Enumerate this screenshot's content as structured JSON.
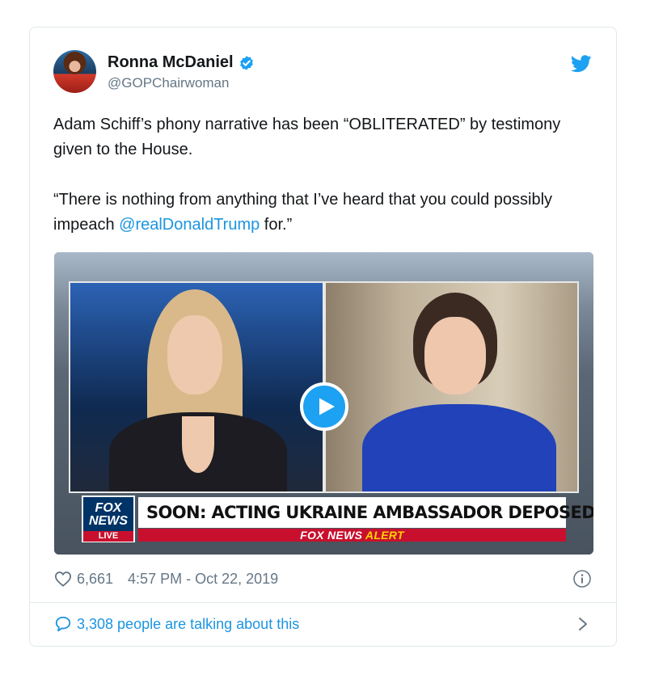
{
  "tweet": {
    "author_name": "Ronna McDaniel",
    "handle": "@GOPChairwoman",
    "verified": true,
    "text_para1": "Adam Schiff’s phony narrative has been “OBLITERATED” by testimony given to the House.",
    "text_para2_before": "“There is nothing from anything that I’ve heard that you could possibly impeach ",
    "text_para2_mention": "@realDonaldTrump",
    "text_para2_after": " for.”"
  },
  "media": {
    "logo_line1": "FOX",
    "logo_line2": "NEWS",
    "logo_live": "LIVE",
    "headline": "SOON: ACTING UKRAINE AMBASSADOR DEPOSED",
    "alert_brand": "FOX NEWS",
    "alert_word": "ALERT"
  },
  "meta": {
    "likes": "6,661",
    "timestamp": "4:57 PM - Oct 22, 2019"
  },
  "footer": {
    "talking": "3,308 people are talking about this"
  },
  "colors": {
    "link": "#1b95e0",
    "twitter_blue": "#1da1f2",
    "secondary_text": "#657786",
    "fox_red": "#c8102e"
  },
  "icons": [
    "twitter-bird-icon",
    "verified-badge-icon",
    "play-icon",
    "heart-icon",
    "info-icon",
    "speech-bubble-icon",
    "chevron-right-icon"
  ]
}
